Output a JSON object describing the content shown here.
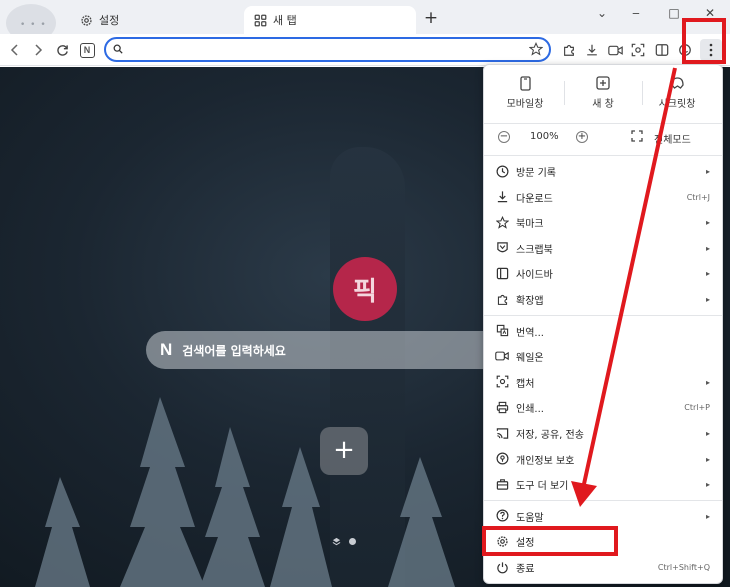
{
  "tabs": [
    {
      "label": "설정",
      "icon": "gear-icon"
    },
    {
      "label": "새 탭",
      "icon": "grid-icon"
    }
  ],
  "window_controls": {
    "minimize": "‒",
    "maximize": "□",
    "close": "✕",
    "dropdown": "⌄"
  },
  "newtab_symbol": "+",
  "omnibox": {
    "value": "",
    "placeholder": ""
  },
  "page": {
    "badge_text": "픽",
    "search_placeholder": "검색어를 입력하세요",
    "search_logo": "N",
    "add_symbol": "+"
  },
  "menu": {
    "top_items": [
      {
        "label": "모바일창",
        "icon": "mobile-icon"
      },
      {
        "label": "새 창",
        "icon": "new-window-icon"
      },
      {
        "label": "시크릿창",
        "icon": "secret-icon"
      }
    ],
    "zoom": {
      "minus": "−",
      "value": "100%",
      "plus": "+",
      "fullscreen_label": "전체모드"
    },
    "items": [
      {
        "label": "방문 기록",
        "icon": "history-icon",
        "shortcut": "",
        "submenu": true
      },
      {
        "label": "다운로드",
        "icon": "download-icon",
        "shortcut": "Ctrl+J",
        "submenu": false
      },
      {
        "label": "북마크",
        "icon": "star-icon",
        "shortcut": "",
        "submenu": true
      },
      {
        "label": "스크랩북",
        "icon": "scrapbook-icon",
        "shortcut": "",
        "submenu": true
      },
      {
        "label": "사이드바",
        "icon": "sidebar-icon",
        "shortcut": "",
        "submenu": true
      },
      {
        "label": "확장앱",
        "icon": "puzzle-icon",
        "shortcut": "",
        "submenu": true
      },
      {
        "label": "번역...",
        "icon": "translate-icon",
        "shortcut": "",
        "submenu": false
      },
      {
        "label": "웨일온",
        "icon": "video-icon",
        "shortcut": "",
        "submenu": false
      },
      {
        "label": "캡처",
        "icon": "capture-icon",
        "shortcut": "",
        "submenu": true
      },
      {
        "label": "인쇄...",
        "icon": "print-icon",
        "shortcut": "Ctrl+P",
        "submenu": false
      },
      {
        "label": "저장, 공유, 전송",
        "icon": "cast-icon",
        "shortcut": "",
        "submenu": true
      },
      {
        "label": "개인정보 보호",
        "icon": "privacy-icon",
        "shortcut": "",
        "submenu": true
      },
      {
        "label": "도구 더 보기",
        "icon": "toolbox-icon",
        "shortcut": "",
        "submenu": true
      },
      {
        "label": "도움말",
        "icon": "help-icon",
        "shortcut": "",
        "submenu": true
      },
      {
        "label": "설정",
        "icon": "gear-icon",
        "shortcut": "",
        "submenu": false
      },
      {
        "label": "종료",
        "icon": "power-icon",
        "shortcut": "Ctrl+Shift+Q",
        "submenu": false
      }
    ]
  },
  "colors": {
    "highlight": "#e0191e",
    "omnibox_border": "#2d6ae3",
    "badge": "#b5264a"
  }
}
